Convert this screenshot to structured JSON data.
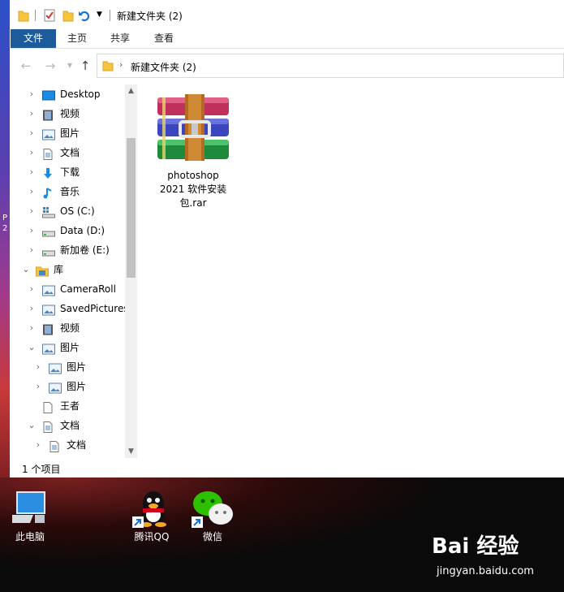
{
  "window": {
    "title": "新建文件夹 (2)",
    "ribbon_tabs": [
      "文件",
      "主页",
      "共享",
      "查看"
    ],
    "address_path": "新建文件夹 (2)",
    "status": "1 个项目"
  },
  "nav": {
    "items": [
      {
        "label": "Desktop",
        "icon": "desktop-icon",
        "expanded": false
      },
      {
        "label": "视频",
        "icon": "video-folder-icon",
        "expanded": false
      },
      {
        "label": "图片",
        "icon": "pictures-folder-icon",
        "expanded": false
      },
      {
        "label": "文档",
        "icon": "documents-folder-icon",
        "expanded": false
      },
      {
        "label": "下载",
        "icon": "downloads-folder-icon",
        "expanded": false
      },
      {
        "label": "音乐",
        "icon": "music-folder-icon",
        "expanded": false
      },
      {
        "label": "OS (C:)",
        "icon": "system-drive-icon",
        "expanded": false
      },
      {
        "label": "Data (D:)",
        "icon": "drive-icon",
        "expanded": false
      },
      {
        "label": "新加卷 (E:)",
        "icon": "drive-icon",
        "expanded": false
      },
      {
        "label": "库",
        "icon": "libraries-icon",
        "expanded": true
      },
      {
        "label": "CameraRoll",
        "icon": "library-folder-icon",
        "expanded": false
      },
      {
        "label": "SavedPictures",
        "icon": "library-folder-icon",
        "expanded": false
      },
      {
        "label": "视频",
        "icon": "video-folder-icon",
        "expanded": false
      },
      {
        "label": "图片",
        "icon": "pictures-folder-icon",
        "expanded": true
      },
      {
        "label": "图片",
        "icon": "pictures-folder-icon",
        "expanded": false
      },
      {
        "label": "图片",
        "icon": "pictures-folder-icon",
        "expanded": false
      },
      {
        "label": "王者",
        "icon": "document-icon",
        "expanded": false
      },
      {
        "label": "文档",
        "icon": "documents-folder-icon",
        "expanded": true
      },
      {
        "label": "文档",
        "icon": "documents-folder-icon",
        "expanded": false
      }
    ]
  },
  "content": {
    "file": {
      "name_line1": "photoshop",
      "name_line2": "2021 软件安装",
      "name_line3": "包.rar",
      "icon": "winrar-archive-icon"
    }
  },
  "desktop": {
    "icons": [
      {
        "label": "此电脑",
        "icon": "this-pc-icon"
      },
      {
        "label": "腾讯QQ",
        "icon": "qq-icon"
      },
      {
        "label": "微信",
        "icon": "wechat-icon"
      }
    ],
    "left_peek": [
      "P",
      "2"
    ]
  },
  "watermark": {
    "brand": "Bai 经验",
    "url": "jingyan.baidu.com"
  },
  "colors": {
    "file_tab": "#1e5b9b",
    "folder_yellow": "#f5c542",
    "accent_blue": "#1b8ae2"
  }
}
